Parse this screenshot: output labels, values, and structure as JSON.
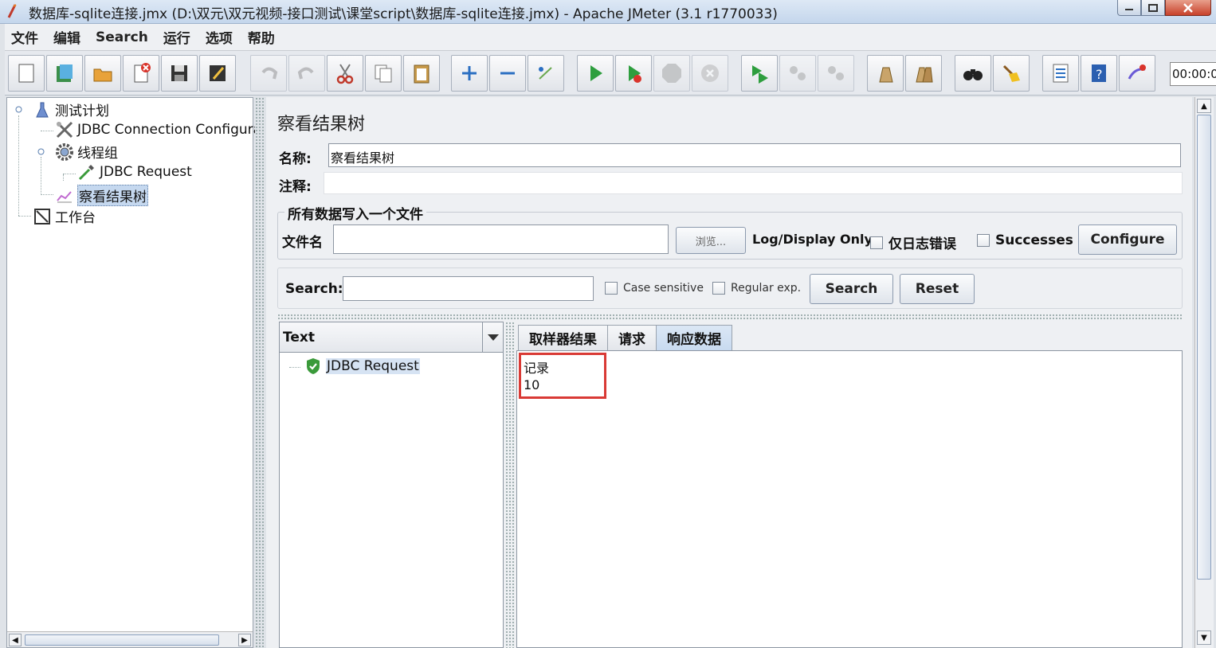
{
  "window": {
    "title": "数据库-sqlite连接.jmx (D:\\双元\\双元视频-接口测试\\课堂script\\数据库-sqlite连接.jmx) - Apache JMeter (3.1 r1770033)"
  },
  "menu": [
    "文件",
    "编辑",
    "Search",
    "运行",
    "选项",
    "帮助"
  ],
  "toolbar": {
    "buttons": [
      "new-icon",
      "templates-icon",
      "open-icon",
      "close-icon",
      "save-icon",
      "save-as-icon",
      "undo-icon",
      "redo-icon",
      "cut-icon",
      "copy-icon",
      "paste-icon",
      "expand-icon",
      "collapse-icon",
      "toggle-icon",
      "start-icon",
      "start-no-timers-icon",
      "stop-icon",
      "shutdown-icon",
      "remote-start-icon",
      "remote-stop-icon",
      "remote-exit-icon",
      "clear-icon",
      "clear-all-icon",
      "search-icon",
      "reset-search-icon",
      "function-helper-icon",
      "help-icon",
      "log-viewer-icon"
    ],
    "timer": "00:00:0"
  },
  "tree": {
    "test_plan": "测试计划",
    "jdbc_config": "JDBC Connection Configura",
    "thread_group": "线程组",
    "jdbc_request": "JDBC Request",
    "view_results": "察看结果树",
    "workbench": "工作台"
  },
  "panel": {
    "title": "察看结果树",
    "name_label": "名称:",
    "name_value": "察看结果树",
    "comment_label": "注释:",
    "comment_value": "",
    "file_group_legend": "所有数据写入一个文件",
    "filename_label": "文件名",
    "filename_value": "",
    "browse_label": "浏览...",
    "log_display_label": "Log/Display Only:",
    "errors_only_label": "仅日志错误",
    "successes_label": "Successes",
    "configure_label": "Configure",
    "search_label": "Search:",
    "search_value": "",
    "case_sensitive_label": "Case sensitive",
    "regex_label": "Regular exp.",
    "search_button": "Search",
    "reset_button": "Reset"
  },
  "results": {
    "renderer": "Text",
    "items": [
      "JDBC Request"
    ],
    "tabs": [
      "取样器结果",
      "请求",
      "响应数据"
    ],
    "active_tab": "响应数据",
    "response_lines": [
      "记录",
      "10"
    ]
  }
}
